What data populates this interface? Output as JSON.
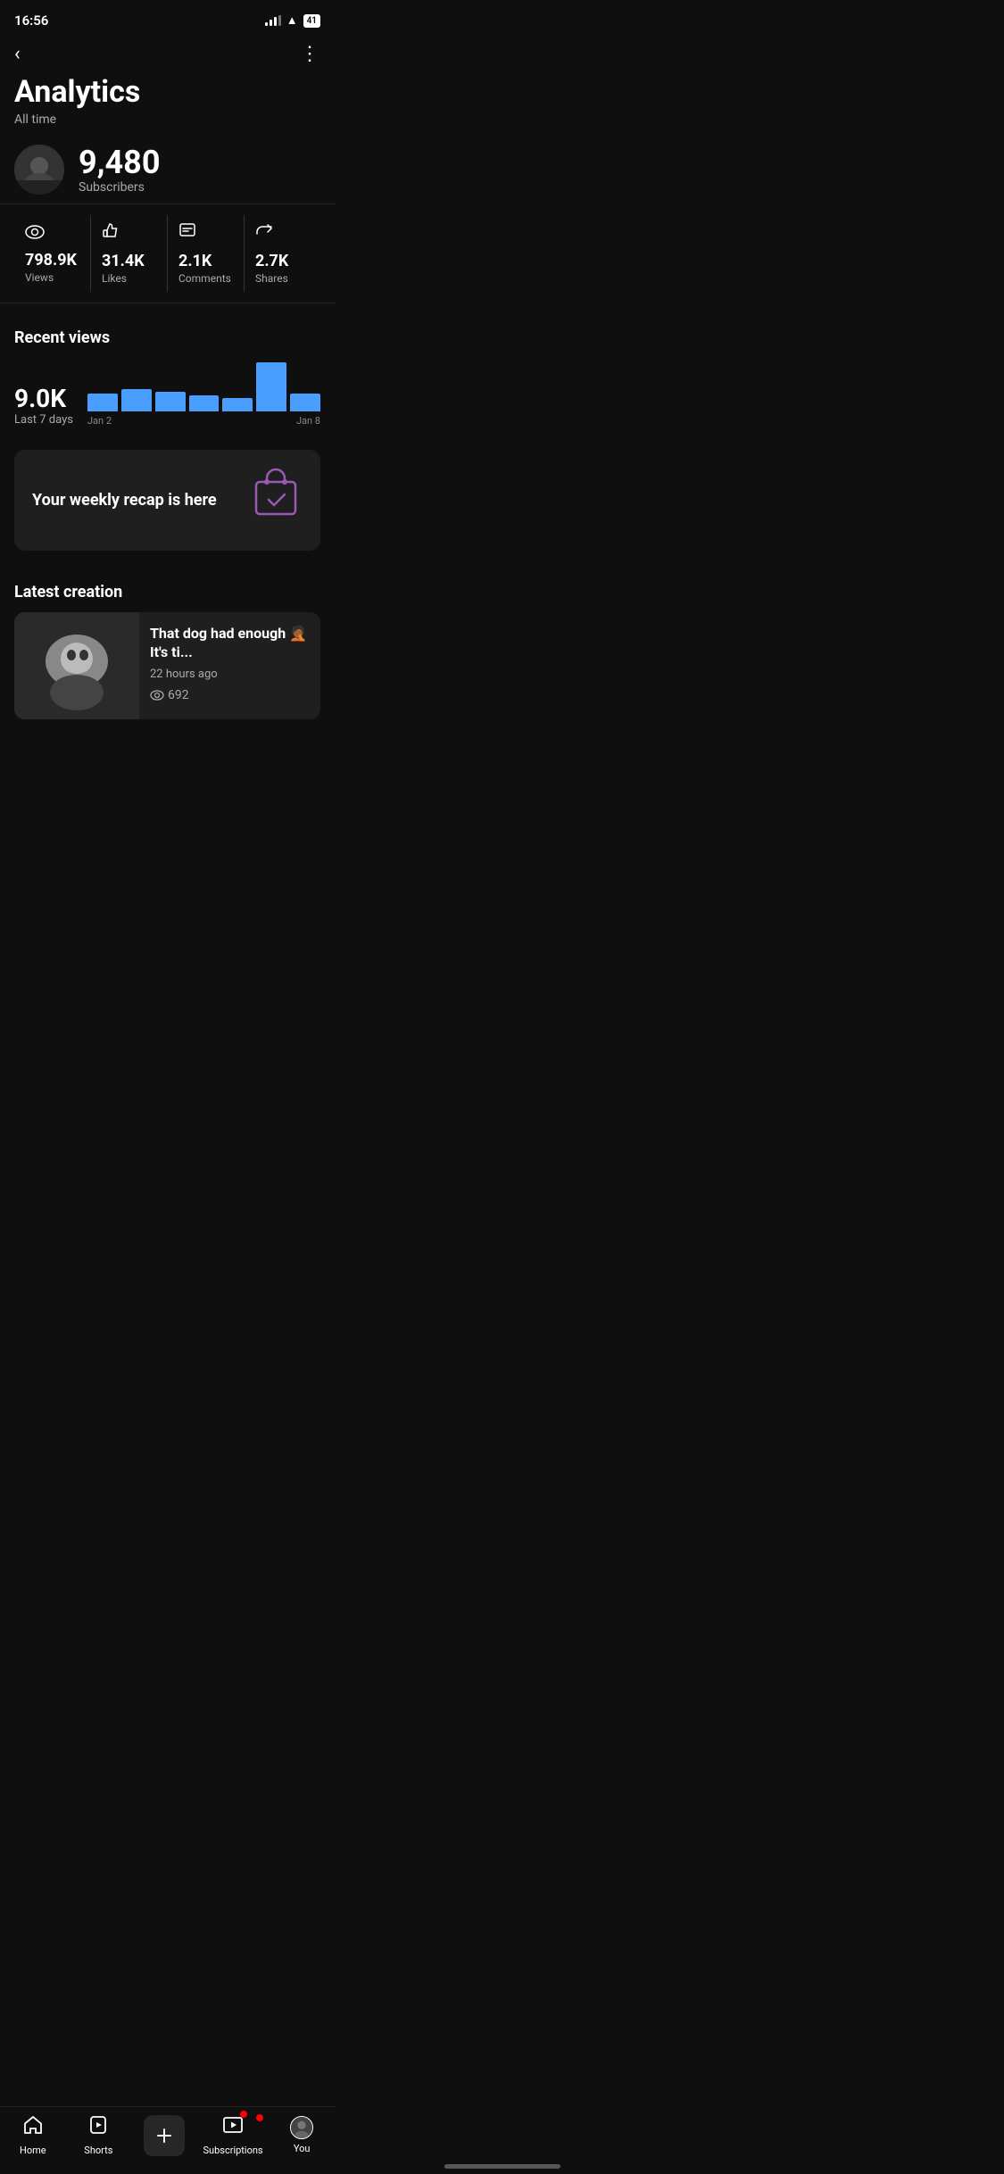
{
  "statusBar": {
    "time": "16:56",
    "battery": "41"
  },
  "nav": {
    "backLabel": "‹",
    "moreLabel": "⋮"
  },
  "page": {
    "title": "Analytics",
    "subtitle": "All time"
  },
  "channel": {
    "subscriberCount": "9,480",
    "subscriberLabel": "Subscribers"
  },
  "stats": [
    {
      "icon": "👁",
      "value": "798.9K",
      "label": "Views"
    },
    {
      "icon": "👍",
      "value": "31.4K",
      "label": "Likes"
    },
    {
      "icon": "💬",
      "value": "2.1K",
      "label": "Comments"
    },
    {
      "icon": "↗",
      "value": "2.7K",
      "label": "Shares"
    }
  ],
  "recentViews": {
    "title": "Recent views",
    "value": "9.0K",
    "period": "Last 7 days",
    "chartLabelLeft": "Jan 2",
    "chartLabelRight": "Jan 8",
    "bars": [
      20,
      25,
      22,
      18,
      15,
      55,
      20
    ]
  },
  "recap": {
    "text": "Your weekly recap is here",
    "icon": "🛍️"
  },
  "latestCreation": {
    "sectionTitle": "Latest creation",
    "title": "That dog had enough 🤦🏾 It's ti...",
    "time": "22 hours ago",
    "views": "692"
  },
  "bottomNav": {
    "items": [
      {
        "id": "home",
        "label": "Home",
        "icon": "🏠"
      },
      {
        "id": "shorts",
        "label": "Shorts",
        "icon": "▶"
      },
      {
        "id": "create",
        "label": "",
        "icon": "+"
      },
      {
        "id": "subscriptions",
        "label": "Subscriptions",
        "icon": "📋",
        "badge": true
      },
      {
        "id": "you",
        "label": "You",
        "icon": "👤"
      }
    ]
  }
}
